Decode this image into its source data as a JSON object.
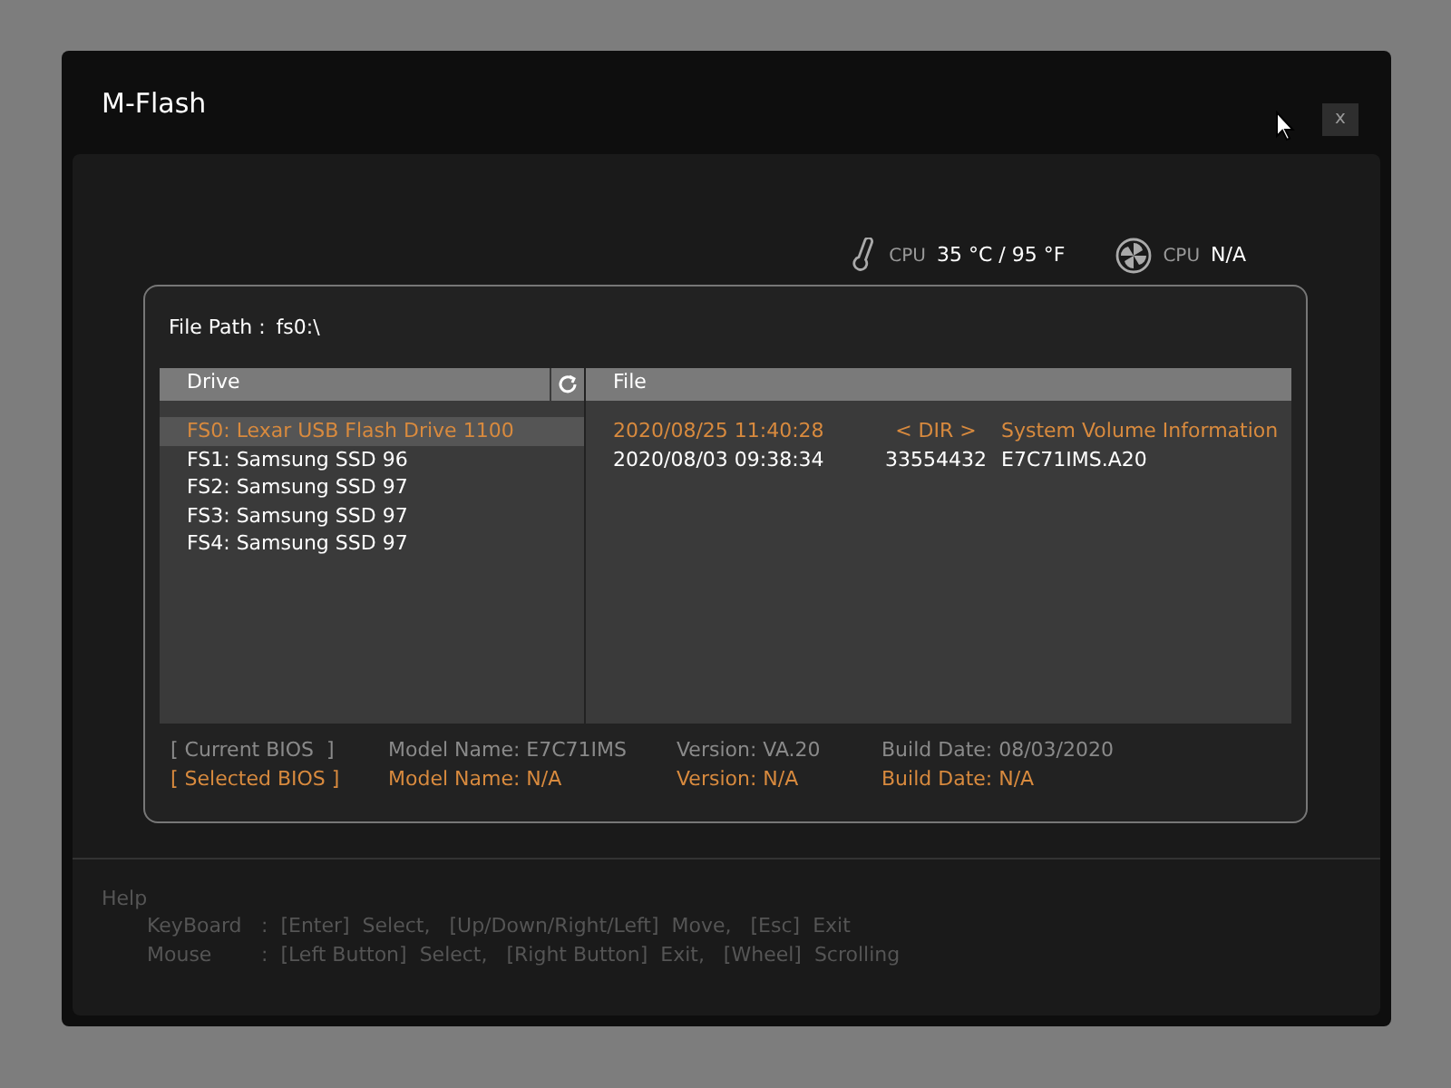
{
  "window": {
    "title": "M-Flash",
    "close_label": "x"
  },
  "sensors": [
    {
      "kind": "temperature",
      "label": "CPU",
      "value": "35 °C / 95 °F"
    },
    {
      "kind": "fan",
      "label": "CPU",
      "value": "N/A"
    }
  ],
  "file_path": {
    "label": "File Path :",
    "value": "fs0:\\"
  },
  "drives": {
    "heading": "Drive",
    "items": [
      {
        "label": "FS0: Lexar USB Flash Drive 1100",
        "selected": true
      },
      {
        "label": "FS1: Samsung SSD 96",
        "selected": false
      },
      {
        "label": "FS2: Samsung SSD 97",
        "selected": false
      },
      {
        "label": "FS3: Samsung SSD 97",
        "selected": false
      },
      {
        "label": "FS4: Samsung SSD 97",
        "selected": false
      }
    ]
  },
  "files": {
    "heading": "File",
    "rows": [
      {
        "date": "2020/08/25 11:40:28",
        "size": "< DIR >",
        "name": "System Volume Information",
        "selected": true
      },
      {
        "date": "2020/08/03 09:38:34",
        "size": "33554432",
        "name": "E7C71IMS.A20",
        "selected": false
      }
    ]
  },
  "bios": [
    {
      "kind": "current",
      "label": "[ Current BIOS  ]",
      "model": "Model Name: E7C71IMS",
      "version": "Version: VA.20",
      "date": "Build Date: 08/03/2020"
    },
    {
      "kind": "selected",
      "label": "[ Selected BIOS ]",
      "model": "Model Name: N/A",
      "version": "Version: N/A",
      "date": "Build Date: N/A"
    }
  ],
  "help": {
    "title": "Help",
    "lines": [
      {
        "device": "KeyBoard",
        "text": ":  [Enter]  Select,   [Up/Down/Right/Left]  Move,   [Esc]  Exit"
      },
      {
        "device": "Mouse",
        "text": ":  [Left Button]  Select,   [Right Button]  Exit,   [Wheel]  Scrolling"
      }
    ]
  }
}
